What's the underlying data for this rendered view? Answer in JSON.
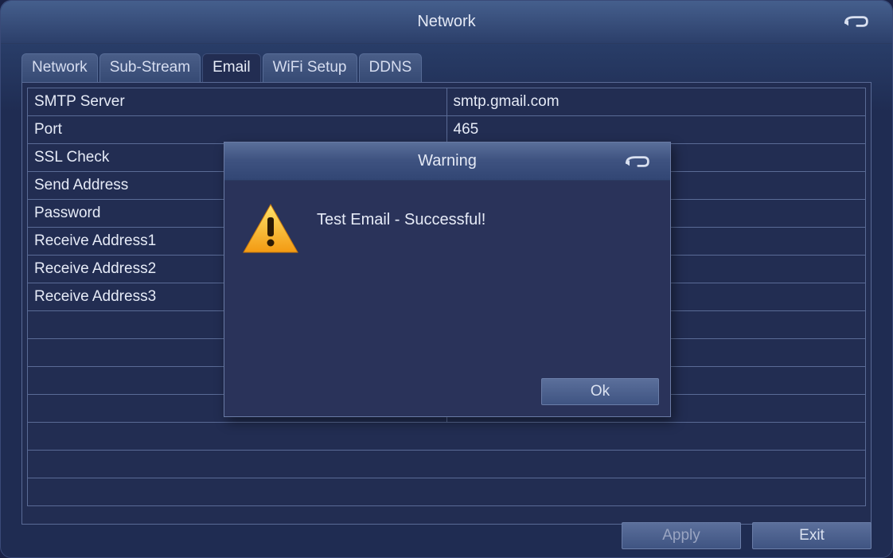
{
  "window": {
    "title": "Network"
  },
  "tabs": [
    {
      "label": "Network",
      "active": false
    },
    {
      "label": "Sub-Stream",
      "active": false
    },
    {
      "label": "Email",
      "active": true
    },
    {
      "label": "WiFi Setup",
      "active": false
    },
    {
      "label": "DDNS",
      "active": false
    }
  ],
  "form": {
    "rows": [
      {
        "label": "SMTP Server",
        "value": "smtp.gmail.com"
      },
      {
        "label": "Port",
        "value": "465"
      },
      {
        "label": "SSL Check",
        "value": ""
      },
      {
        "label": "Send Address",
        "value": ""
      },
      {
        "label": "Password",
        "value": ""
      },
      {
        "label": "Receive Address1",
        "value": ""
      },
      {
        "label": "Receive Address2",
        "value": ""
      },
      {
        "label": "Receive Address3",
        "value": ""
      }
    ]
  },
  "footer": {
    "apply": "Apply",
    "exit": "Exit"
  },
  "modal": {
    "title": "Warning",
    "message": "Test Email - Successful!",
    "ok": "Ok"
  },
  "icons": {
    "back": "return-arrow",
    "warning": "warning-triangle"
  }
}
